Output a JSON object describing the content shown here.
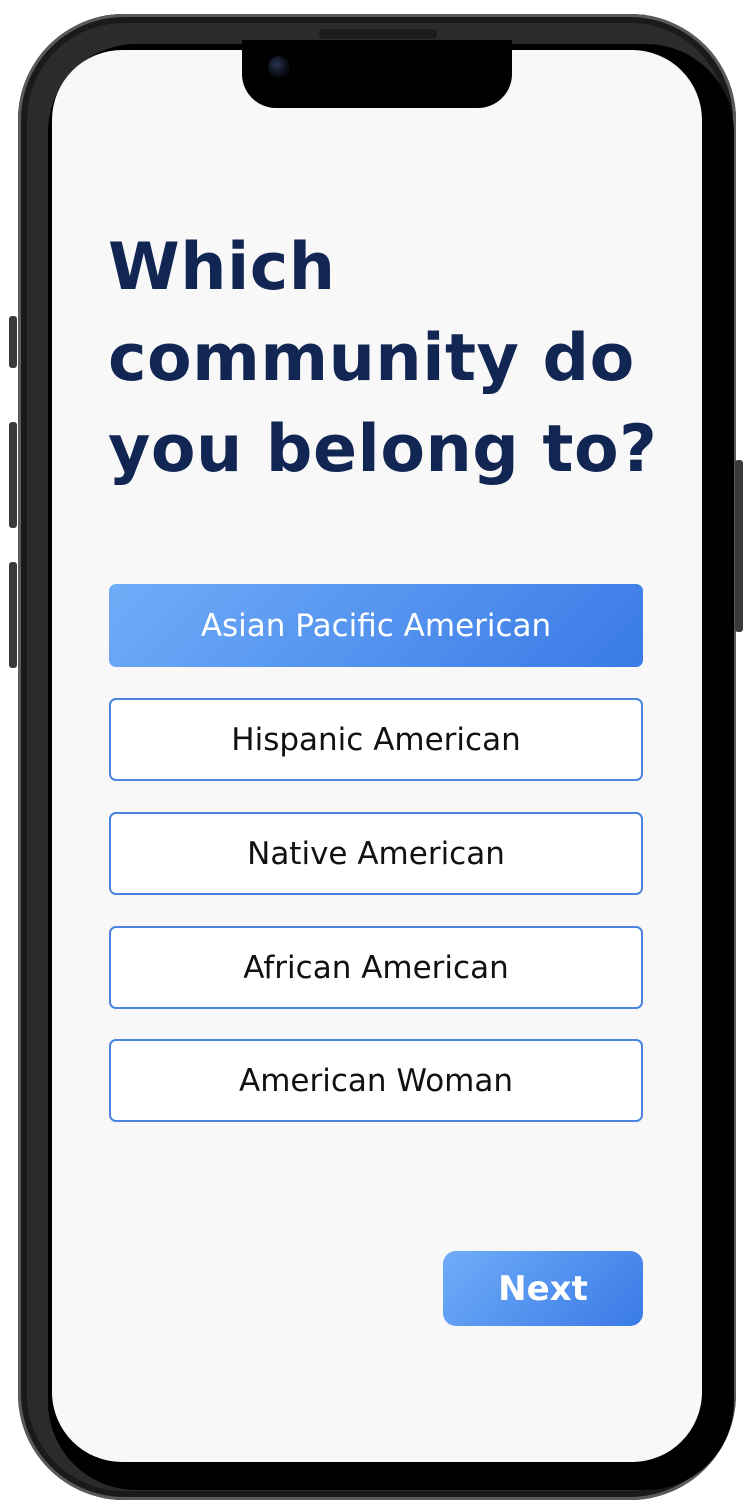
{
  "question": {
    "title": "Which community do you belong to?"
  },
  "options": [
    {
      "label": "Asian Pacific American",
      "selected": true
    },
    {
      "label": "Hispanic American",
      "selected": false
    },
    {
      "label": "Native American",
      "selected": false
    },
    {
      "label": "African American",
      "selected": false
    },
    {
      "label": "American Woman",
      "selected": false
    }
  ],
  "actions": {
    "next_label": "Next"
  },
  "colors": {
    "title": "#112653",
    "accent_start": "#6fadf8",
    "accent_end": "#3a7ae6",
    "option_border": "#4a84e0",
    "screen_background": "#f8f8f8"
  }
}
